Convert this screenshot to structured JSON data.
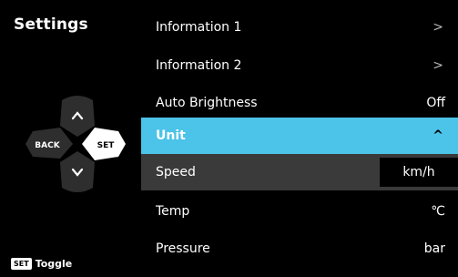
{
  "sidebar": {
    "title": "Settings",
    "dpad": {
      "back_label": "BACK",
      "set_label": "SET"
    },
    "hint": {
      "key": "SET",
      "action": "Toggle"
    }
  },
  "menu": {
    "items": [
      {
        "label": "Information 1",
        "chevron": ">"
      },
      {
        "label": "Information 2",
        "chevron": ">"
      },
      {
        "label": "Auto Brightness",
        "value": "Off"
      }
    ],
    "unit_header": {
      "label": "Unit",
      "chevron": "^"
    },
    "unit_items": [
      {
        "label": "Speed",
        "value": "km/h"
      },
      {
        "label": "Temp",
        "value": "℃"
      },
      {
        "label": "Pressure",
        "value": "bar"
      }
    ]
  },
  "colors": {
    "accent": "#4cc3e8",
    "selected_row": "#3a3a3a",
    "background": "#000000"
  }
}
